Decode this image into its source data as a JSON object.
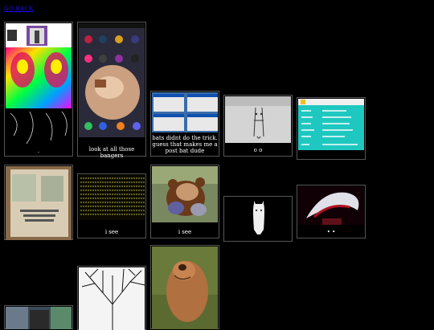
{
  "nav": {
    "back_link": "GO BACK"
  },
  "tiles": [
    {
      "caption": "."
    },
    {
      "caption": "look at all those bangers"
    },
    {
      "caption": "bats didnt do the trick. guess that makes me a post bat dude"
    },
    {
      "caption": "o o"
    },
    {
      "caption": ""
    },
    {
      "caption": ""
    },
    {
      "caption": "i see"
    },
    {
      "caption": "i see"
    },
    {
      "caption": ""
    },
    {
      "caption": "• •"
    },
    {
      "caption": ""
    },
    {
      "caption": ""
    },
    {
      "caption": ""
    }
  ],
  "colors": {
    "background": "#000000",
    "link": "#1a0dff",
    "tile_border": "#555555"
  }
}
